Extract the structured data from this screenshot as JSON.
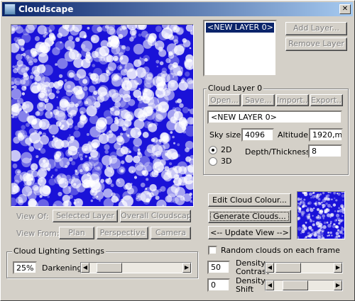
{
  "window": {
    "title": "Cloudscape",
    "close_icon": "close-icon",
    "app_icon": "cloudscape-app-icon"
  },
  "layers": {
    "items": [
      "<NEW LAYER 0>"
    ],
    "add_label": "Add Layer...",
    "remove_label": "Remove Layer"
  },
  "preview": {
    "view_of_label": "View Of:",
    "selected_layer": "Selected Layer",
    "overall": "Overall Cloudscape",
    "view_from_label": "View From:",
    "plan": "Plan",
    "perspective": "Perspective",
    "camera": "Camera"
  },
  "lighting": {
    "title": "Cloud Lighting Settings",
    "value": "25%",
    "label": "Darkening",
    "level": 0.1
  },
  "layer": {
    "group_title": "Cloud Layer 0",
    "open": "Open...",
    "save": "Save...",
    "import": "Import...",
    "export": "Export...",
    "name": "<NEW LAYER 0>",
    "sky_size_label": "Sky size",
    "sky_size": "4096",
    "altitude_label": "Altitude",
    "altitude": "1920,m",
    "mode_2d": "2D",
    "mode_3d": "3D",
    "selected_mode": "2D",
    "depth_label": "Depth/Thickness",
    "depth": "8"
  },
  "actions": {
    "edit_colour": "Edit Cloud Colour...",
    "generate": "Generate Clouds...",
    "update_view": "<-- Update View -->"
  },
  "random": {
    "label": "Random clouds on each frame",
    "checked": false
  },
  "density": {
    "contrast_value": "50",
    "contrast_label_1": "Density",
    "contrast_label_2": "Contrast",
    "contrast_level": 0.05,
    "shift_value": "0",
    "shift_label_1": "Density",
    "shift_label_2": "Shift",
    "shift_level": 0.25
  },
  "colors": {
    "sky": "#1a12d8",
    "cloud": "#ffffff"
  }
}
